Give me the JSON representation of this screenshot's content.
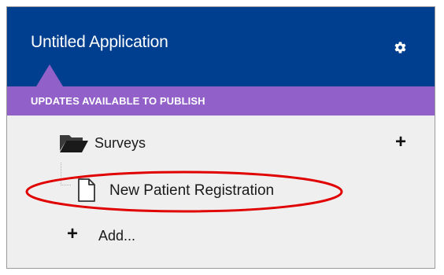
{
  "header": {
    "title": "Untitled Application",
    "settings_icon": "gear-icon",
    "background": "#003f8f"
  },
  "banner": {
    "text": "UPDATES AVAILABLE TO PUBLISH",
    "background": "#9160c9"
  },
  "tree": {
    "folder": {
      "label": "Surveys",
      "icon": "folder-open-icon",
      "add_icon": "plus-icon"
    },
    "items": [
      {
        "label": "New Patient Registration",
        "icon": "document-icon",
        "highlighted": true
      }
    ],
    "add_action": {
      "label": "Add...",
      "icon": "plus-icon"
    }
  },
  "annotation": {
    "color": "#e00000"
  }
}
